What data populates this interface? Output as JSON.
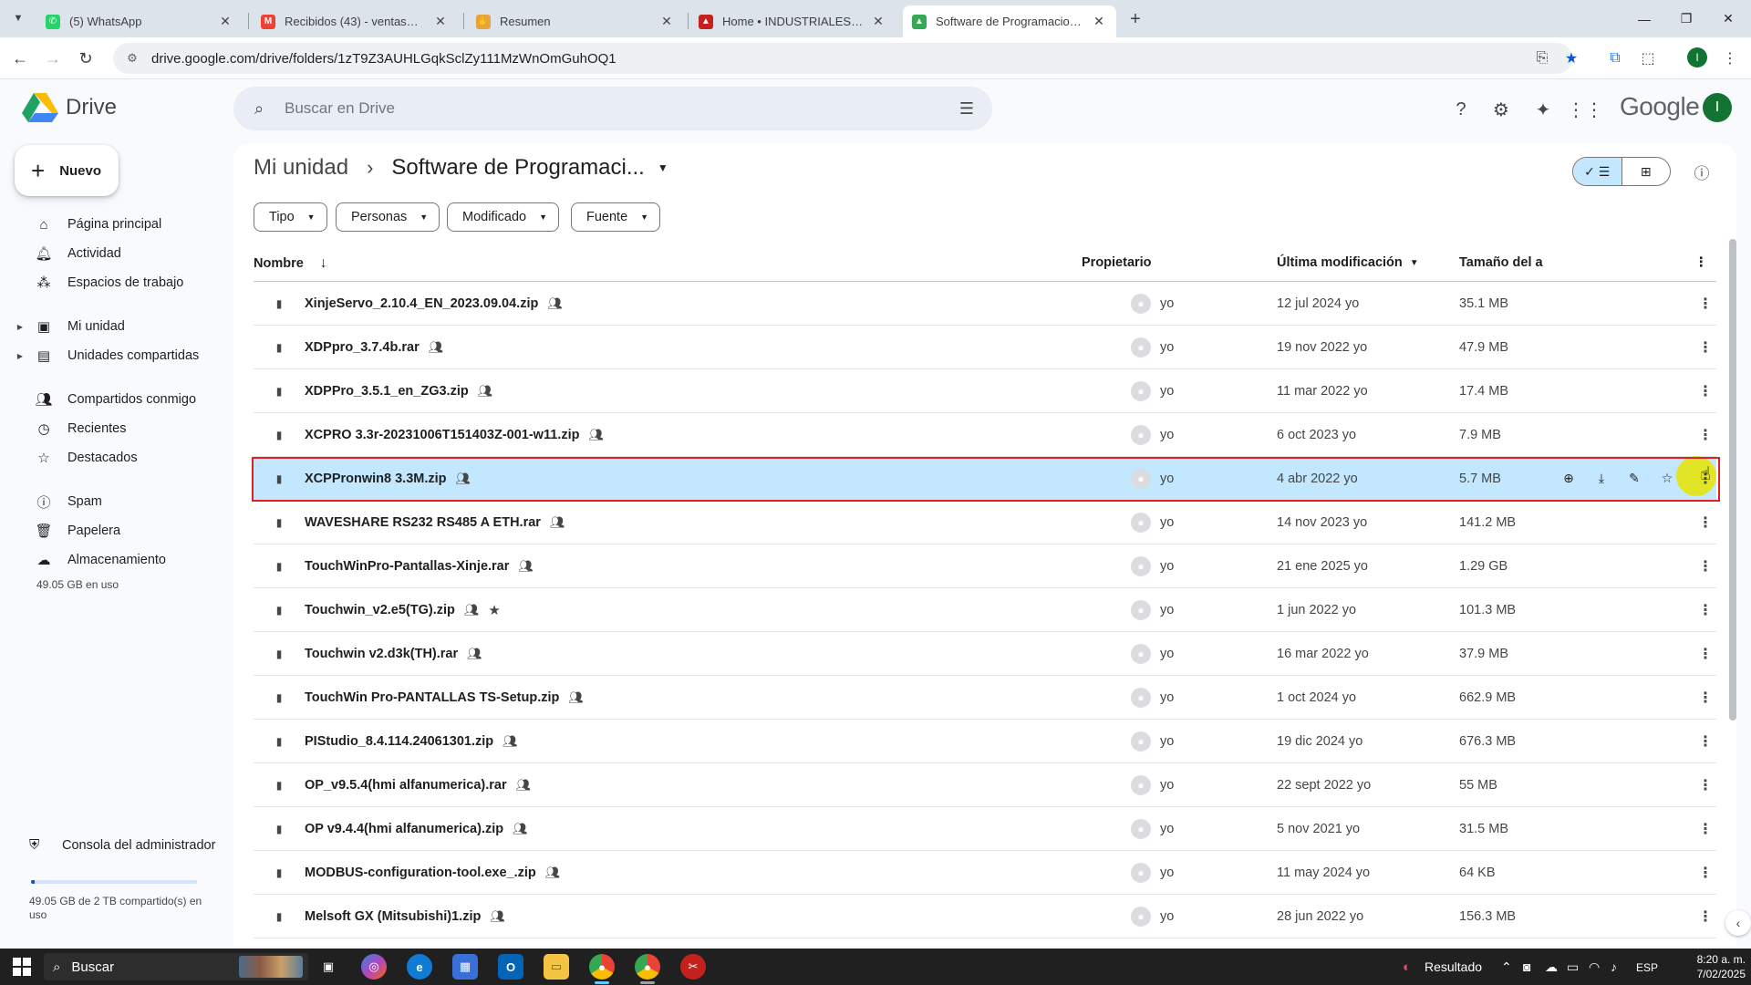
{
  "browser": {
    "tabs": [
      {
        "title": "(5) WhatsApp",
        "favicon_color": "#25d366",
        "favicon": "whatsapp-icon"
      },
      {
        "title": "Recibidos (43) - ventas@industr",
        "favicon_color": "#ea4335",
        "favicon": "gmail-icon"
      },
      {
        "title": "Resumen",
        "favicon_color": "#e8a33d",
        "favicon": "handshake-icon"
      },
      {
        "title": "Home • INDUSTRIALES ANDES",
        "favicon_color": "#c5221f",
        "favicon": "site-icon"
      },
      {
        "title": "Software de Programacion - Go",
        "favicon_color": "#34a853",
        "favicon": "drive-icon"
      }
    ],
    "active_tab": 4,
    "url": "drive.google.com/drive/folders/1zT9Z3AUHLGqkSclZy111MzWnOmGuhOQ1"
  },
  "drive": {
    "app_name": "Drive",
    "brand_word": "Google",
    "account_initial": "I",
    "search_placeholder": "Buscar en Drive",
    "new_label": "Nuevo",
    "nav": [
      {
        "label": "Página principal",
        "icon": "home-icon",
        "caret": false
      },
      {
        "label": "Actividad",
        "icon": "bell-icon",
        "caret": false
      },
      {
        "label": "Espacios de trabajo",
        "icon": "workspaces-icon",
        "caret": false
      },
      {
        "label": "Mi unidad",
        "icon": "my-drive-icon",
        "caret": true
      },
      {
        "label": "Unidades compartidas",
        "icon": "shared-drives-icon",
        "caret": true
      },
      {
        "label": "Compartidos conmigo",
        "icon": "shared-with-me-icon",
        "caret": false
      },
      {
        "label": "Recientes",
        "icon": "clock-icon",
        "caret": false
      },
      {
        "label": "Destacados",
        "icon": "star-icon",
        "caret": false
      },
      {
        "label": "Spam",
        "icon": "spam-icon",
        "caret": false
      },
      {
        "label": "Papelera",
        "icon": "trash-icon",
        "caret": false
      },
      {
        "label": "Almacenamiento",
        "icon": "cloud-icon",
        "caret": false
      }
    ],
    "storage_used": "49.05 GB en uso",
    "admin_console": "Consola del administrador",
    "quota_text": "49.05 GB de 2 TB compartido(s) en uso",
    "quota_fraction": 0.024,
    "breadcrumb": {
      "parent": "Mi unidad",
      "current": "Software de Programaci..."
    },
    "filters": [
      "Tipo",
      "Personas",
      "Modificado",
      "Fuente"
    ],
    "columns": {
      "name": "Nombre",
      "owner": "Propietario",
      "modified": "Última modificación",
      "size": "Tamaño del a"
    },
    "files": [
      {
        "name": "XinjeServo_2.10.4_EN_2023.09.04.zip",
        "owner": "yo",
        "modified": "12 jul 2024 yo",
        "size": "35.1 MB",
        "starred": false,
        "selected": false
      },
      {
        "name": "XDPpro_3.7.4b.rar",
        "owner": "yo",
        "modified": "19 nov 2022 yo",
        "size": "47.9 MB",
        "starred": false,
        "selected": false
      },
      {
        "name": "XDPPro_3.5.1_en_ZG3.zip",
        "owner": "yo",
        "modified": "11 mar 2022 yo",
        "size": "17.4 MB",
        "starred": false,
        "selected": false
      },
      {
        "name": "XCPRO 3.3r-20231006T151403Z-001-w11.zip",
        "owner": "yo",
        "modified": "6 oct 2023 yo",
        "size": "7.9 MB",
        "starred": false,
        "selected": false
      },
      {
        "name": "XCPPronwin8 3.3M.zip",
        "owner": "yo",
        "modified": "4 abr 2022 yo",
        "size": "5.7 MB",
        "starred": false,
        "selected": true
      },
      {
        "name": "WAVESHARE RS232 RS485 A ETH.rar",
        "owner": "yo",
        "modified": "14 nov 2023 yo",
        "size": "141.2 MB",
        "starred": false,
        "selected": false
      },
      {
        "name": "TouchWinPro-Pantallas-Xinje.rar",
        "owner": "yo",
        "modified": "21 ene 2025 yo",
        "size": "1.29 GB",
        "starred": false,
        "selected": false
      },
      {
        "name": "Touchwin_v2.e5(TG).zip",
        "owner": "yo",
        "modified": "1 jun 2022 yo",
        "size": "101.3 MB",
        "starred": true,
        "selected": false
      },
      {
        "name": "Touchwin v2.d3k(TH).rar",
        "owner": "yo",
        "modified": "16 mar 2022 yo",
        "size": "37.9 MB",
        "starred": false,
        "selected": false
      },
      {
        "name": "TouchWin Pro-PANTALLAS TS-Setup.zip",
        "owner": "yo",
        "modified": "1 oct 2024 yo",
        "size": "662.9 MB",
        "starred": false,
        "selected": false
      },
      {
        "name": "PIStudio_8.4.114.24061301.zip",
        "owner": "yo",
        "modified": "19 dic 2024 yo",
        "size": "676.3 MB",
        "starred": false,
        "selected": false
      },
      {
        "name": "OP_v9.5.4(hmi alfanumerica).rar",
        "owner": "yo",
        "modified": "22 sept 2022 yo",
        "size": "55 MB",
        "starred": false,
        "selected": false
      },
      {
        "name": "OP v9.4.4(hmi alfanumerica).zip",
        "owner": "yo",
        "modified": "5 nov 2021 yo",
        "size": "31.5 MB",
        "starred": false,
        "selected": false
      },
      {
        "name": "MODBUS-configuration-tool.exe_.zip",
        "owner": "yo",
        "modified": "11 may 2024 yo",
        "size": "64 KB",
        "starred": false,
        "selected": false
      },
      {
        "name": "Melsoft GX (Mitsubishi)1.zip",
        "owner": "yo",
        "modified": "28 jun 2022 yo",
        "size": "156.3 MB",
        "starred": false,
        "selected": false
      }
    ]
  },
  "taskbar": {
    "search_label": "Buscar",
    "tray_label": "Resultado",
    "lang": "ESP",
    "time": "8:20 a. m.",
    "date": "7/02/2025"
  },
  "colors": {
    "accent": "#0b57d0",
    "selected_row": "#c2e7ff",
    "highlight_outline": "#e02020"
  }
}
